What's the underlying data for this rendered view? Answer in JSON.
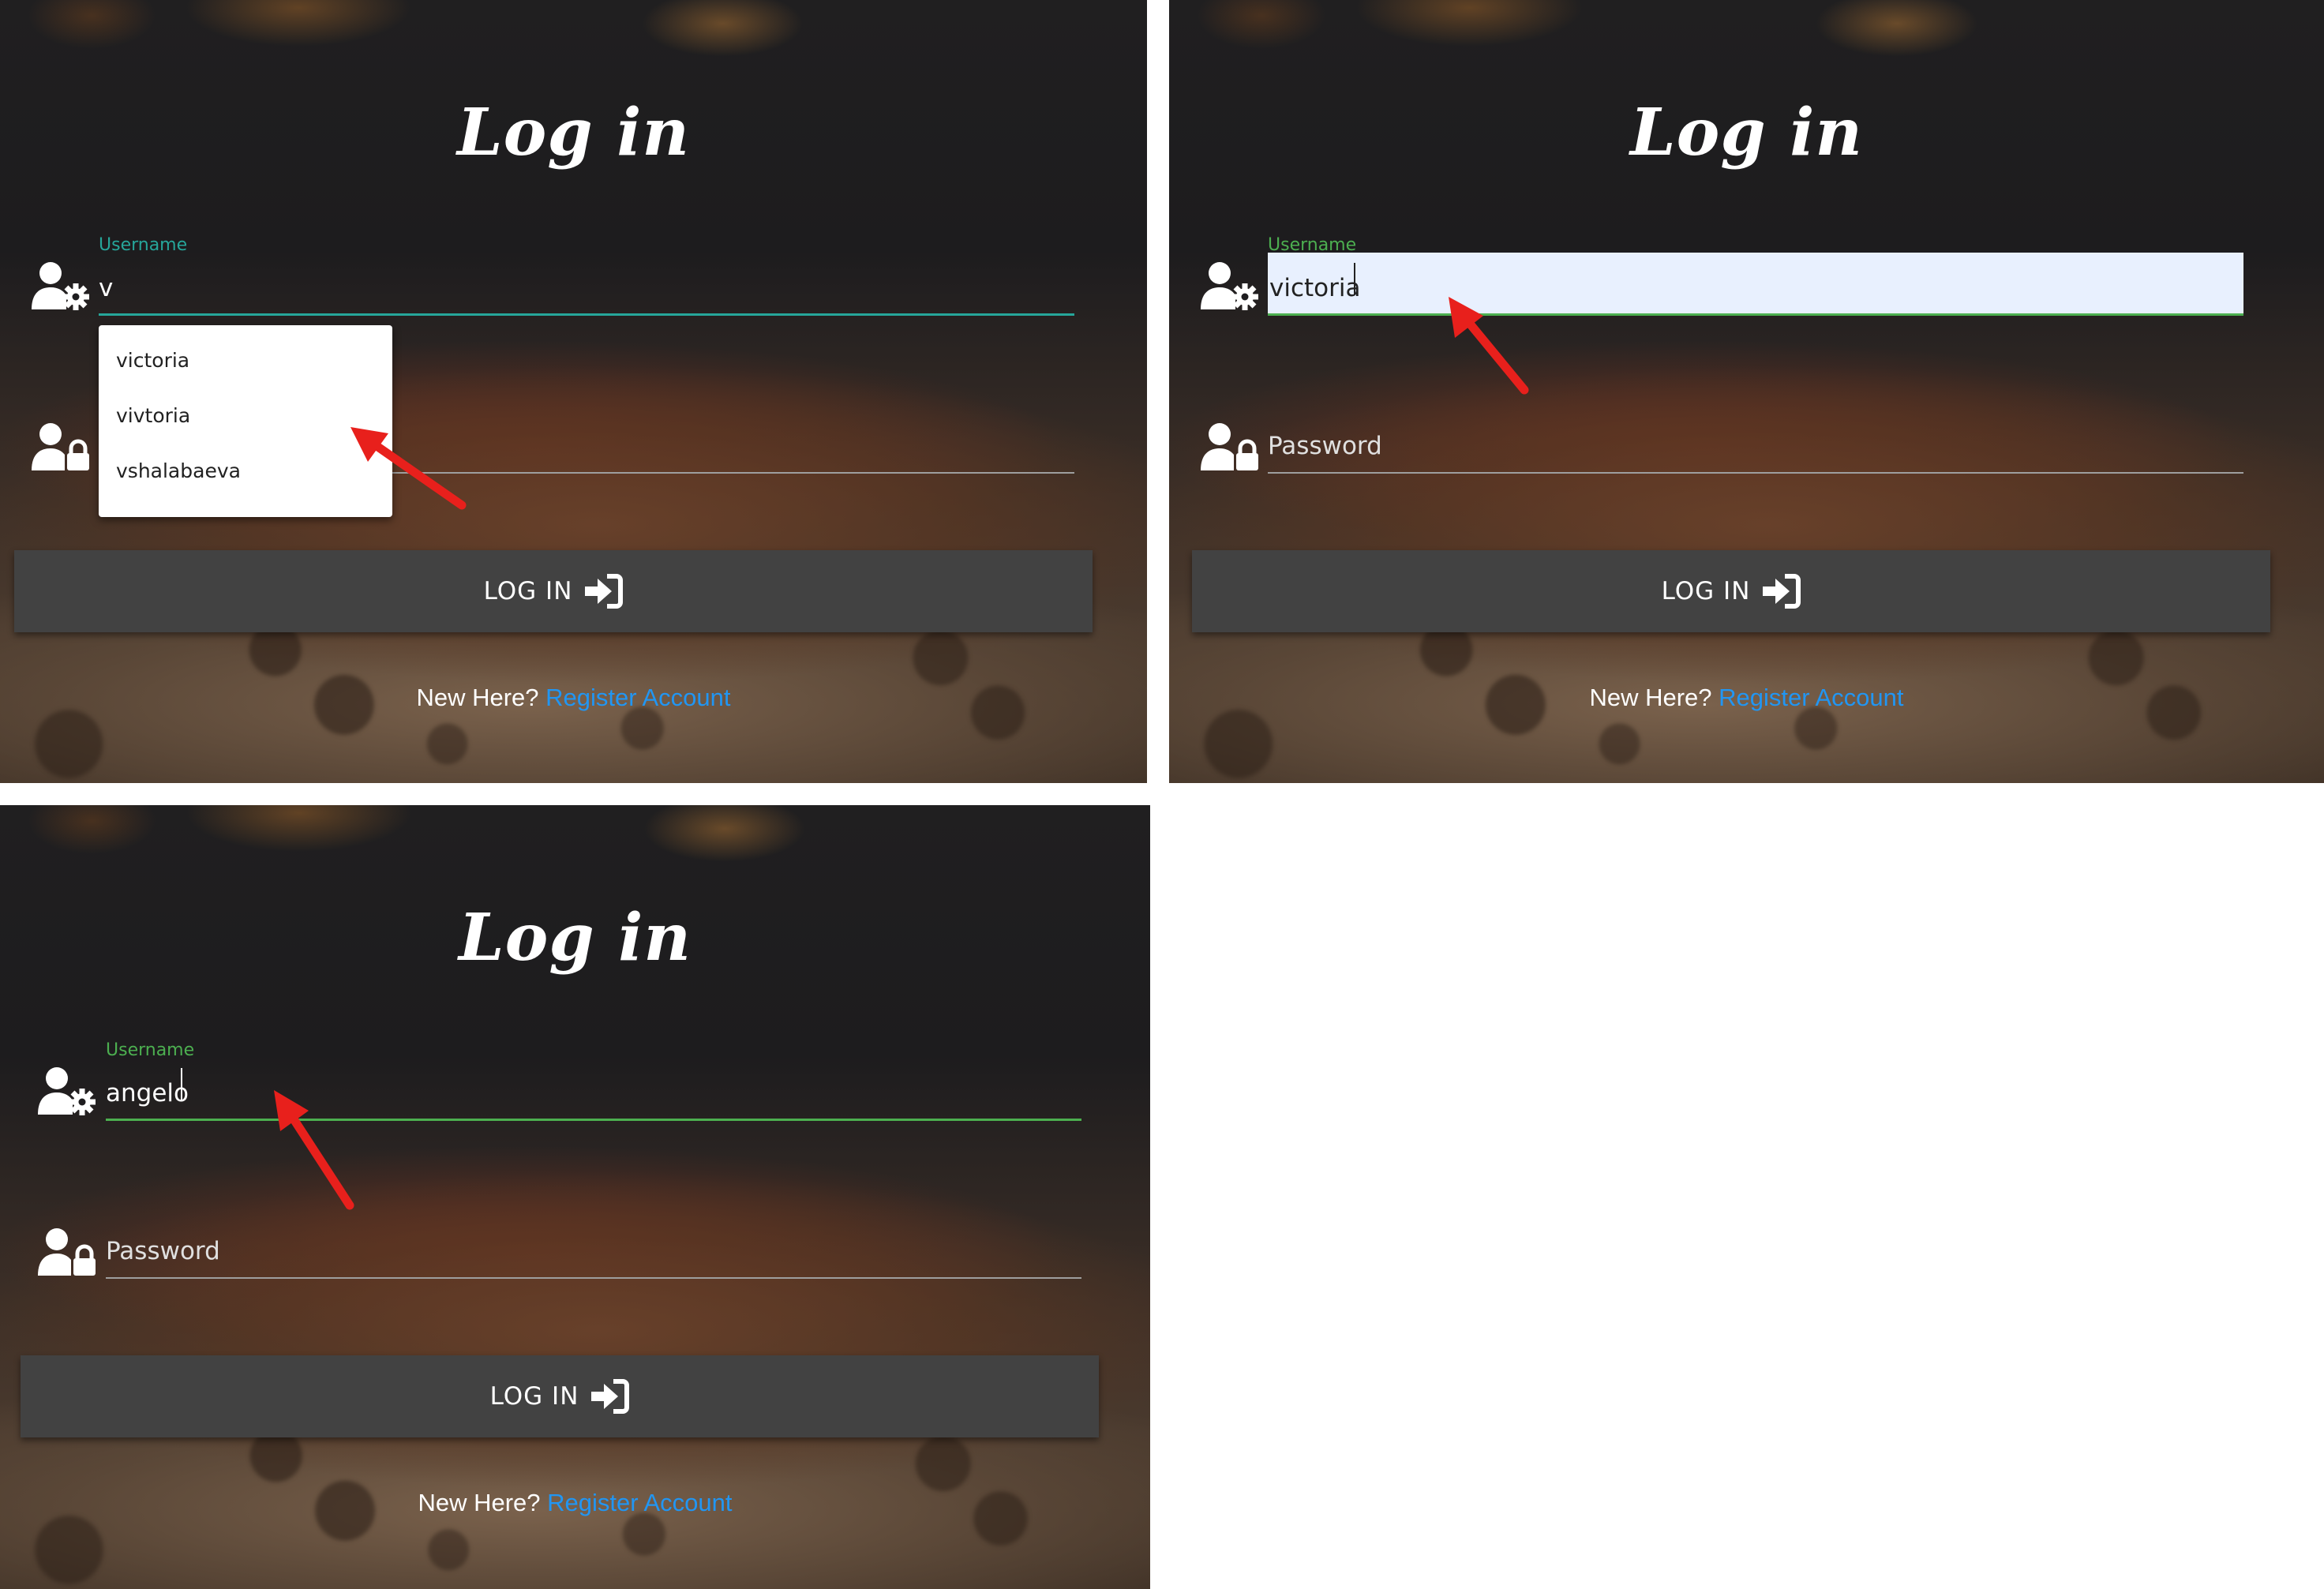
{
  "panels": [
    {
      "title": "Log in",
      "username": {
        "label": "Username",
        "value": "v"
      },
      "password": {
        "placeholder": ""
      },
      "autocomplete": [
        "victoria",
        "vivtoria",
        "vshalabaeva"
      ],
      "button": {
        "label": "LOG IN"
      },
      "footer": {
        "prompt": "New Here?",
        "link": "Register Account"
      }
    },
    {
      "title": "Log in",
      "username": {
        "label": "Username",
        "value": "victoria"
      },
      "password": {
        "placeholder": "Password"
      },
      "button": {
        "label": "LOG IN"
      },
      "footer": {
        "prompt": "New Here?",
        "link": "Register Account"
      }
    },
    {
      "title": "Log in",
      "username": {
        "label": "Username",
        "value": "angelo"
      },
      "password": {
        "placeholder": "Password"
      },
      "button": {
        "label": "LOG IN"
      },
      "footer": {
        "prompt": "New Here?",
        "link": "Register Account"
      }
    }
  ],
  "colors": {
    "accent_teal": "#26a69a",
    "accent_green": "#4caf50",
    "link": "#2196f3",
    "button_bg": "#424242",
    "autofill_bg": "#e8f0fe",
    "annotation_arrow": "#e8201c"
  },
  "icons": [
    "user-gear-icon",
    "user-lock-icon",
    "sign-in-icon",
    "annotation-arrow"
  ]
}
